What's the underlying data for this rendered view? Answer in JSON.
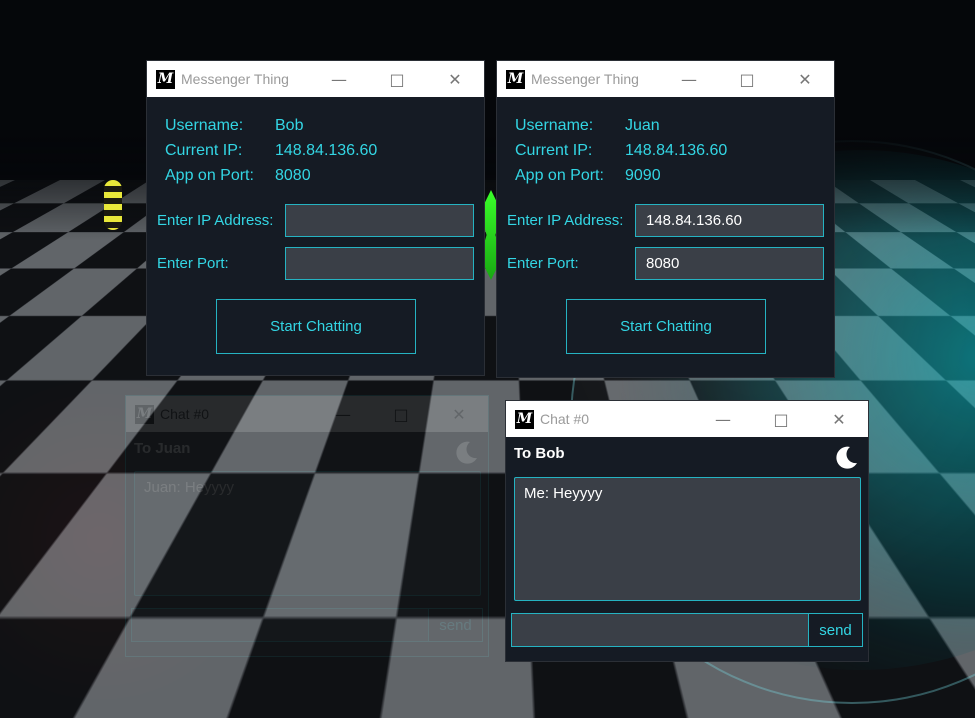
{
  "colors": {
    "window_bg": "#151b24",
    "accent": "#33d6e4",
    "input_bg": "#3a3f47",
    "border": "#25b3c2"
  },
  "messenger_windows": [
    {
      "title": "Messenger Thing",
      "username_label": "Username:",
      "username": "Bob",
      "ip_label": "Current IP:",
      "ip": "148.84.136.60",
      "port_label": "App on Port:",
      "port": "8080",
      "enter_ip_label": "Enter IP Address:",
      "enter_ip_value": "",
      "enter_port_label": "Enter Port:",
      "enter_port_value": "",
      "start_button": "Start Chatting"
    },
    {
      "title": "Messenger Thing",
      "username_label": "Username:",
      "username": "Juan",
      "ip_label": "Current IP:",
      "ip": "148.84.136.60",
      "port_label": "App on Port:",
      "port": "9090",
      "enter_ip_label": "Enter IP Address:",
      "enter_ip_value": "148.84.136.60",
      "enter_port_label": "Enter Port:",
      "enter_port_value": "8080",
      "start_button": "Start Chatting"
    }
  ],
  "chat_windows": [
    {
      "title": "Chat #0",
      "to": "To Juan",
      "messages": [
        "Juan: Heyyyy"
      ],
      "input_value": "",
      "send_label": "send",
      "theme_icon": "moon-icon"
    },
    {
      "title": "Chat #0",
      "to": "To Bob",
      "messages": [
        "Me: Heyyyy"
      ],
      "input_value": "",
      "send_label": "send",
      "theme_icon": "moon-icon"
    }
  ],
  "titlebar_icons": {
    "minimize": "minimize-icon",
    "maximize": "maximize-icon",
    "close": "close-icon"
  }
}
